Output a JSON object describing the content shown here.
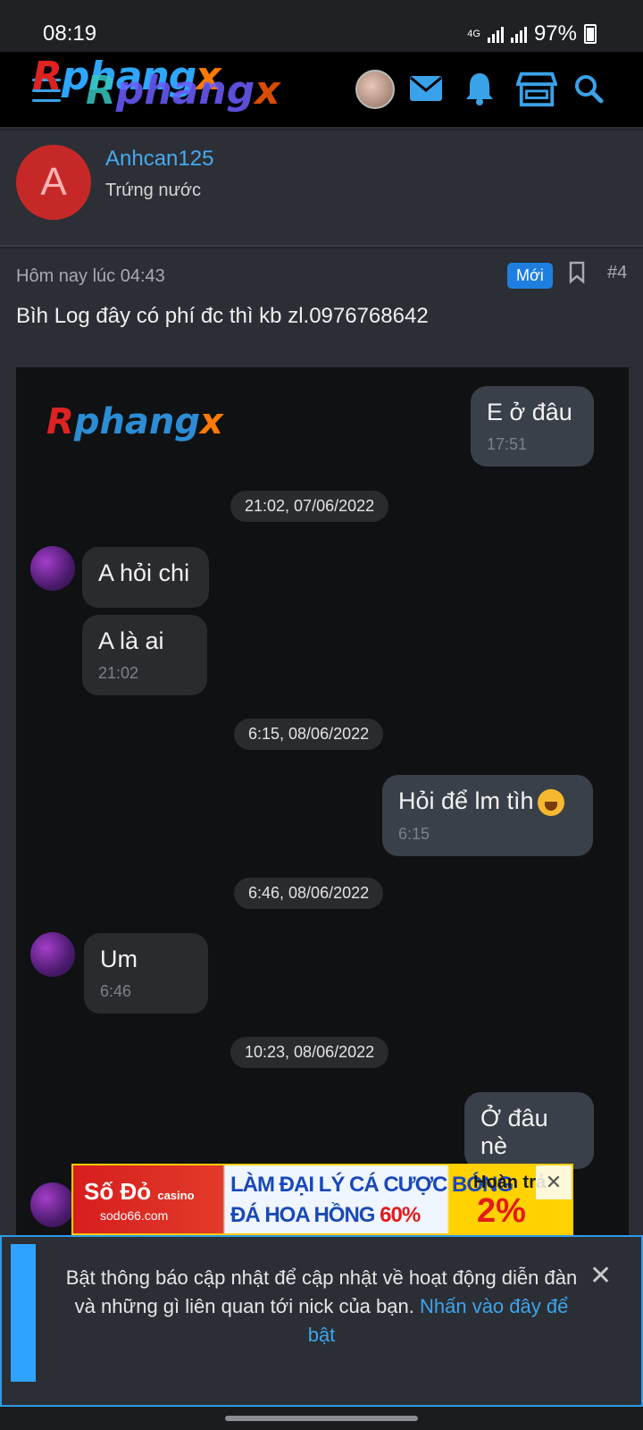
{
  "status_bar": {
    "time": "08:19",
    "network": "4G",
    "battery": "97%"
  },
  "header": {
    "logo_parts": [
      "R",
      "phang",
      "x"
    ],
    "icons": [
      "menu-icon",
      "user-avatar",
      "mail-icon",
      "bell-icon",
      "store-icon",
      "search-icon"
    ]
  },
  "author": {
    "avatar_letter": "A",
    "name": "Anhcan125",
    "title": "Trứng nước"
  },
  "post": {
    "date": "Hôm nay lúc 04:43",
    "badge": "Mới",
    "number": "#4",
    "text": "Bìh Log đây có phí đc thì kb zl.0976768642"
  },
  "chat": {
    "watermark": [
      "R",
      "phang",
      "x"
    ],
    "messages": [
      {
        "dir": "out",
        "text": "E ở đâu",
        "time": "17:51"
      },
      {
        "type": "date",
        "text": "21:02, 07/06/2022"
      },
      {
        "dir": "in",
        "text": "A hỏi chi",
        "time": ""
      },
      {
        "dir": "in",
        "text": "A là ai",
        "time": "21:02"
      },
      {
        "type": "date",
        "text": "6:15, 08/06/2022"
      },
      {
        "dir": "out",
        "text": "Hỏi để lm tìh",
        "time": "6:15"
      },
      {
        "type": "date",
        "text": "6:46, 08/06/2022"
      },
      {
        "dir": "in",
        "text": "Um",
        "time": "6:46"
      },
      {
        "type": "date",
        "text": "10:23, 08/06/2022"
      },
      {
        "dir": "out",
        "text": "Ở đâu nè",
        "time": ""
      }
    ]
  },
  "ad": {
    "brand": "Số Đỏ",
    "brand_tag": "casino",
    "site": "sodo66.com",
    "line1": "LÀM ĐẠI LÝ CÁ CƯỢC BÓNG",
    "line2": "ĐÁ HOA HỒNG",
    "line2_highlight": "60%",
    "right_label": "Hoàn trả",
    "right_value": "2%",
    "close": "✕"
  },
  "notice": {
    "text": "Bật thông báo cập nhật để cập nhật về hoạt động diễn đàn và những gì liên quan tới nick của bạn.",
    "link": "Nhấn vào đây để bật",
    "close": "✕"
  },
  "colors": {
    "accent": "#2ea3ff",
    "link": "#48a9ef",
    "avatar_red": "#c62828"
  }
}
